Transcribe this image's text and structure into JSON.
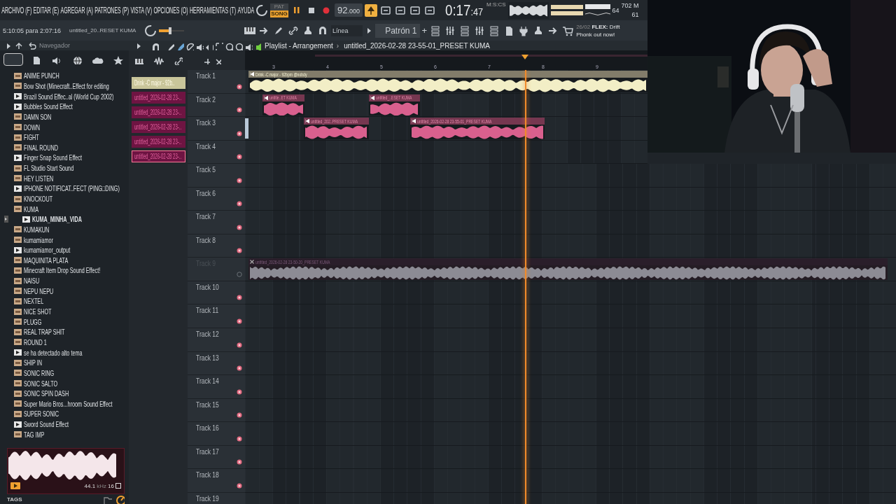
{
  "menu": [
    "ARCHIVO (F)",
    "EDITAR (E)",
    "AGREGAR (A)",
    "PATRONES (P)",
    "VISTA (V)",
    "OPCIONES (O)",
    "HERRAMIENTAS (T)",
    "AYUDA"
  ],
  "transport": {
    "modes": [
      {
        "label": "PAT",
        "selected": false
      },
      {
        "label": "SONG",
        "selected": true
      }
    ],
    "tempo": "92",
    "tempo_fraction": ".000",
    "time": "0:17",
    "time_fraction": ":47",
    "time_unit": "M:S:CS",
    "cpu": "64",
    "memory": "702 M",
    "polyphony": "61"
  },
  "toolbar": {
    "pitch": {
      "level": 0.45
    },
    "hint": "5:10:05 para 2:07:16",
    "project": "untitled_20..RESET KUMA",
    "snap": "Línea",
    "pattern": "Patrón 1",
    "pattern_add": "+",
    "news_date": "26/02",
    "news_text": "**FLEX:** Drift Phonk out now!"
  },
  "browser": {
    "title": "Navegador",
    "items": [
      {
        "label": "ANIME PUNCH",
        "kind": "mp3"
      },
      {
        "label": "Bow Shot (Minecraft..Effect for editing",
        "kind": "mp3"
      },
      {
        "label": "Brazil Sound Effec..al (World Cup 2002)",
        "kind": "wav"
      },
      {
        "label": "Bubbles Sound Effect",
        "kind": "wav"
      },
      {
        "label": "DAMN SON",
        "kind": "mp3"
      },
      {
        "label": "DOWN",
        "kind": "mp3"
      },
      {
        "label": "FIGHT",
        "kind": "mp3"
      },
      {
        "label": "FINAL ROUND",
        "kind": "mp3"
      },
      {
        "label": "Finger Snap Sound Effect",
        "kind": "wav"
      },
      {
        "label": "FL Studio Start Sound",
        "kind": "mp3"
      },
      {
        "label": "HEY LISTEN",
        "kind": "mp3"
      },
      {
        "label": "IPHONE NOTIFICAT..FECT (PING□DING)",
        "kind": "wav"
      },
      {
        "label": "KNOCKOUT",
        "kind": "mp3"
      },
      {
        "label": "KUMA",
        "kind": "mp3",
        "children": [
          {
            "label": "KUMA_MINHA_VIDA",
            "kind": "wav"
          }
        ]
      },
      {
        "label": "KUMAKUN",
        "kind": "mp3"
      },
      {
        "label": "kumamiamor",
        "kind": "mp3"
      },
      {
        "label": "kumamiamor_output",
        "kind": "wav"
      },
      {
        "label": "MAQUINITA PLATA",
        "kind": "mp3"
      },
      {
        "label": "Minecraft Item Drop Sound Effect!",
        "kind": "mp3"
      },
      {
        "label": "NAISU",
        "kind": "mp3"
      },
      {
        "label": "NEPU NEPU",
        "kind": "mp3"
      },
      {
        "label": "NEXTEL",
        "kind": "mp3"
      },
      {
        "label": "NICE SHOT",
        "kind": "mp3"
      },
      {
        "label": "PLUGG",
        "kind": "mp3"
      },
      {
        "label": "REAL TRAP SHIT",
        "kind": "mp3"
      },
      {
        "label": "ROUND 1",
        "kind": "mp3"
      },
      {
        "label": "se ha detectado alto tema",
        "kind": "wav"
      },
      {
        "label": "SHIP IN",
        "kind": "mp3"
      },
      {
        "label": "SONIC RING",
        "kind": "mp3"
      },
      {
        "label": "SONIC SALTO",
        "kind": "mp3"
      },
      {
        "label": "SONIC SPIN DASH",
        "kind": "mp3"
      },
      {
        "label": "Super Mario Bros...hroom Sound Effect",
        "kind": "mp3"
      },
      {
        "label": "SUPER SONIC",
        "kind": "mp3"
      },
      {
        "label": "Sword Sound Effect",
        "kind": "wav"
      },
      {
        "label": "TAG IMP",
        "kind": "mp3"
      }
    ],
    "preview": {
      "rate": "44.1",
      "rate_unit": "kHz",
      "bits": "16"
    },
    "tags": "TAGS"
  },
  "playlist": {
    "title": "Playlist - Arrangement",
    "separator": "›",
    "pattern_path": "untitled_2026-02-28 23-55-01_PRESET KUMA",
    "ruler": [
      "3",
      "4",
      "5",
      "6",
      "7",
      "8",
      "9"
    ],
    "picker": [
      {
        "label": "Drink -C major - 92b..",
        "color": "#c9c59a",
        "selected": false
      },
      {
        "label": "untitled_2026-02-28 23-..",
        "color": "#6e1442",
        "selected": false
      },
      {
        "label": "untitled_2026-02-28 23-..",
        "color": "#6e1442",
        "selected": false
      },
      {
        "label": "untitled_2026-02-28 23-..",
        "color": "#6e1442",
        "selected": false
      },
      {
        "label": "untitled_2026-02-28 23-..",
        "color": "#6e1442",
        "selected": false
      },
      {
        "label": "untitled_2026-02-28 23-..",
        "color": "#6e1442",
        "selected": true
      }
    ],
    "tracks": [
      {
        "name": "Track 1",
        "muted": false,
        "selected": false,
        "clips": [
          {
            "label": "Drink -C major - 92bpm @nobdy",
            "color": "#f2eec6",
            "muted": false
          }
        ]
      },
      {
        "name": "Track 2",
        "muted": false,
        "selected": false,
        "clips": [
          {
            "label": "untitle..ET KUMA",
            "color": "#d9608e",
            "muted": false
          },
          {
            "label": "untitled_..ESET KUMA",
            "color": "#d9608e",
            "muted": false
          }
        ]
      },
      {
        "name": "Track 3",
        "muted": false,
        "selected": true,
        "clips": [
          {
            "label": "untitled_202..PRESET KUMA",
            "color": "#d9608e",
            "muted": false
          },
          {
            "label": "untitled_2026-02-28 23-55-01_PRESET KUMA",
            "color": "#d9608e",
            "muted": false
          }
        ]
      },
      {
        "name": "Track 4",
        "muted": false,
        "selected": false
      },
      {
        "name": "Track 5",
        "muted": false,
        "selected": false
      },
      {
        "name": "Track 6",
        "muted": false,
        "selected": false
      },
      {
        "name": "Track 7",
        "muted": false,
        "selected": false
      },
      {
        "name": "Track 8",
        "muted": false,
        "selected": false
      },
      {
        "name": "Track 9",
        "muted": true,
        "selected": false,
        "clips": [
          {
            "label": "untitled_2026-02-28 23-50-20_PRESET KUMA",
            "color": "#8c8b94",
            "muted": true
          }
        ]
      },
      {
        "name": "Track 10",
        "muted": false,
        "selected": false
      },
      {
        "name": "Track 11",
        "muted": false,
        "selected": false
      },
      {
        "name": "Track 12",
        "muted": false,
        "selected": false
      },
      {
        "name": "Track 13",
        "muted": false,
        "selected": false
      },
      {
        "name": "Track 14",
        "muted": false,
        "selected": false
      },
      {
        "name": "Track 15",
        "muted": false,
        "selected": false
      },
      {
        "name": "Track 16",
        "muted": false,
        "selected": false
      },
      {
        "name": "Track 17",
        "muted": false,
        "selected": false
      },
      {
        "name": "Track 18",
        "muted": false,
        "selected": false
      },
      {
        "name": "Track 19",
        "muted": false,
        "selected": false
      }
    ]
  }
}
